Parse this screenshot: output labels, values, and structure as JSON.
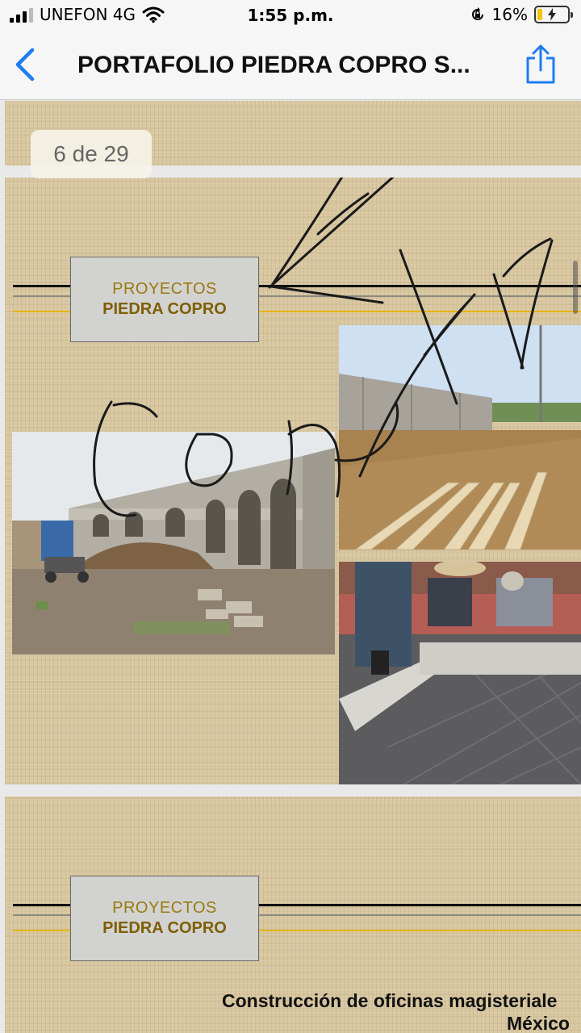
{
  "status_bar": {
    "carrier": "UNEFON 4G",
    "time": "1:55 p.m.",
    "battery": "16%",
    "battery_level": 0.16
  },
  "nav": {
    "title": "PORTAFOLIO PIEDRA COPRO S..."
  },
  "viewer": {
    "page_indicator": "6 de 29"
  },
  "pages": [
    {
      "brand_line1": "PROYECTOS",
      "brand_line2": "PIEDRA COPRO"
    },
    {
      "brand_line1": "PROYECTOS",
      "brand_line2": "PIEDRA COPRO",
      "caption_line1": "Construcción de oficinas magisteriale",
      "caption_line2": "México"
    }
  ],
  "colors": {
    "accent_blue": "#1e7cf2",
    "brand_gold": "#7e5f00",
    "stripe_yellow": "#e8b300"
  }
}
